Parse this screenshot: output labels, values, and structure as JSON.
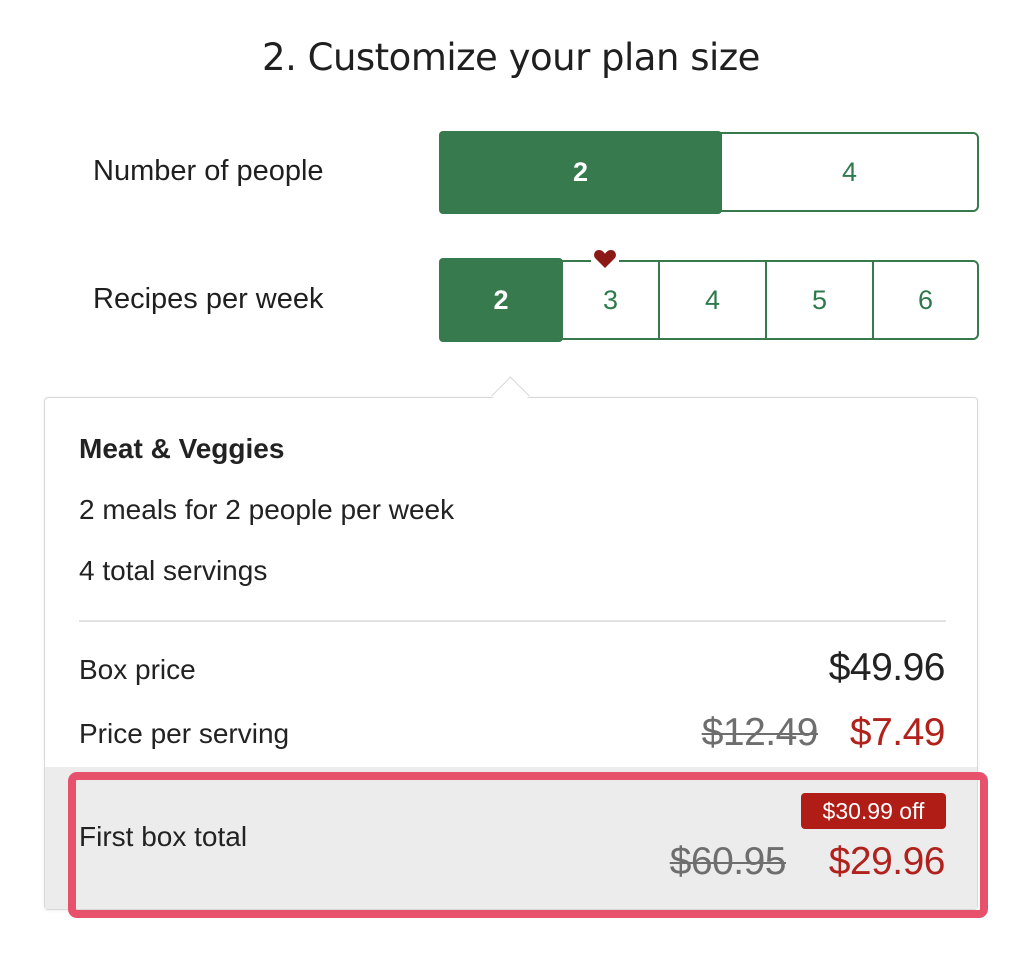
{
  "section_title": "2. Customize your plan size",
  "people": {
    "label": "Number of people",
    "options": [
      "2",
      "4"
    ],
    "selected": "2"
  },
  "recipes": {
    "label": "Recipes per week",
    "options": [
      "2",
      "3",
      "4",
      "5",
      "6"
    ],
    "selected": "2",
    "recommended_icon": "heart-icon"
  },
  "summary": {
    "plan_name": "Meat & Veggies",
    "meals_line": "2 meals for 2 people per week",
    "servings_line": "4 total servings",
    "box_price_label": "Box price",
    "box_price": "$49.96",
    "per_serving_label": "Price per serving",
    "per_serving_original": "$12.49",
    "per_serving_discounted": "$7.49",
    "first_box_label": "First box total",
    "first_box_discount": "$30.99 off",
    "first_box_original": "$60.95",
    "first_box_total": "$29.96"
  },
  "colors": {
    "brand_green": "#367a4e",
    "sale_red": "#b1221c",
    "highlight_pink": "#e8516b",
    "heart_red": "#8b1a17"
  }
}
